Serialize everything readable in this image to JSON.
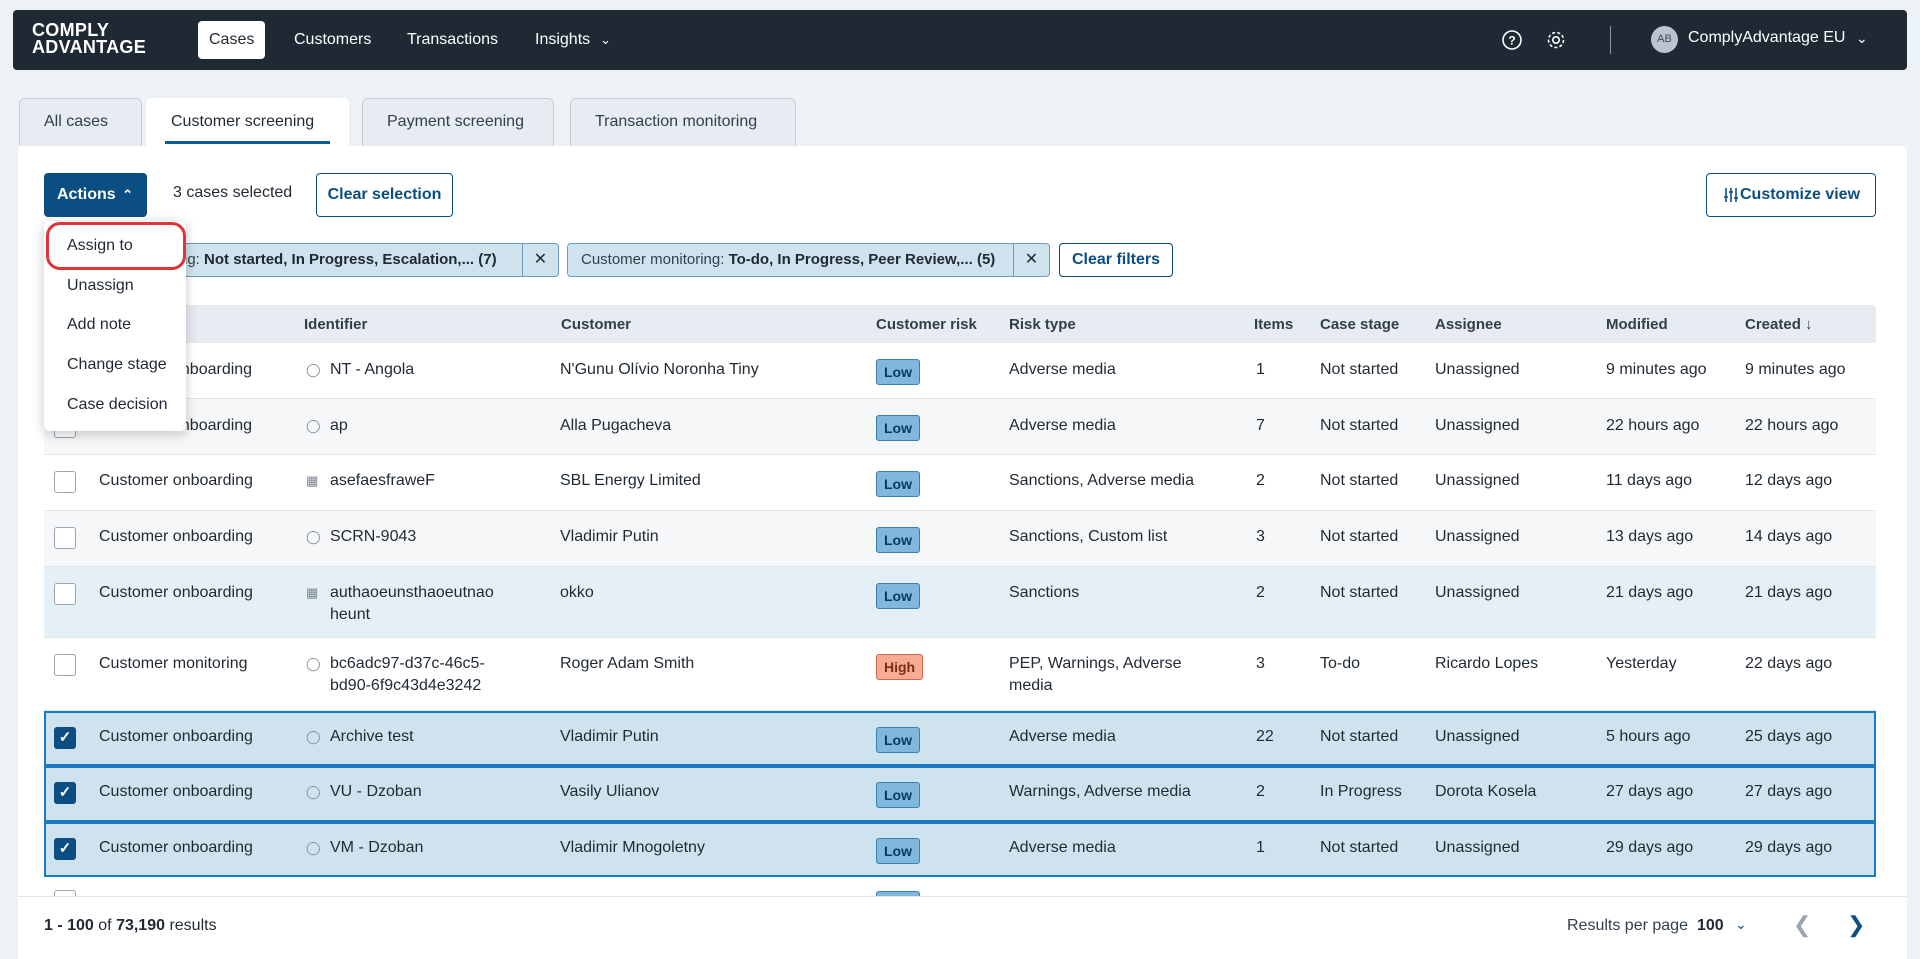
{
  "app": {
    "logo_line1": "COMPLY",
    "logo_line2": "ADVANTAGE"
  },
  "nav": {
    "cases": "Cases",
    "customers": "Customers",
    "transactions": "Transactions",
    "insights": "Insights",
    "account_initials": "AB",
    "account_name": "ComplyAdvantage EU"
  },
  "tabs": [
    "All cases",
    "Customer screening",
    "Payment screening",
    "Transaction monitoring"
  ],
  "toolbar": {
    "actions_label": "Actions",
    "selected_text": "3 cases selected",
    "clear_selection": "Clear selection",
    "customize_view": "Customize view"
  },
  "actions_menu": [
    "Assign to",
    "Unassign",
    "Add note",
    "Change stage",
    "Case decision"
  ],
  "filters": [
    {
      "prefix": "ng:",
      "value": "Not started, In Progress, Escalation,... (7)"
    },
    {
      "prefix": "Customer monitoring:",
      "value": "To-do, In Progress, Peer Review,... (5)"
    }
  ],
  "clear_filters": "Clear filters",
  "table": {
    "headers": {
      "identifier": "Identifier",
      "customer": "Customer",
      "customer_risk": "Customer risk",
      "risk_type": "Risk type",
      "items": "Items",
      "case_stage": "Case stage",
      "assignee": "Assignee",
      "modified": "Modified",
      "created": "Created ↓"
    },
    "rows": [
      {
        "type": "Customer onboarding",
        "visible_type": "onboarding",
        "id1": "NT - Angola",
        "id2": "",
        "customer": "N'Gunu Olívio Noronha Tiny",
        "risk": "Low",
        "risk_type1": "Adverse media",
        "risk_type2": "",
        "items": "1",
        "stage": "Not started",
        "assignee": "Unassigned",
        "modified": "9 minutes ago",
        "created": "9 minutes ago"
      },
      {
        "type": "Customer onboarding",
        "visible_type": "onboarding",
        "id1": "ap",
        "id2": "",
        "customer": "Alla Pugacheva",
        "risk": "Low",
        "risk_type1": "Adverse media",
        "risk_type2": "",
        "items": "7",
        "stage": "Not started",
        "assignee": "Unassigned",
        "modified": "22 hours ago",
        "created": "22 hours ago"
      },
      {
        "type": "Customer onboarding",
        "id1": "asefaesfraweF",
        "id2": "",
        "customer": "SBL Energy Limited",
        "risk": "Low",
        "risk_type1": "Sanctions, Adverse media",
        "risk_type2": "",
        "items": "2",
        "stage": "Not started",
        "assignee": "Unassigned",
        "modified": "11 days ago",
        "created": "12 days ago"
      },
      {
        "type": "Customer onboarding",
        "id1": "SCRN-9043",
        "id2": "",
        "customer": "Vladimir Putin",
        "risk": "Low",
        "risk_type1": "Sanctions, Custom list",
        "risk_type2": "",
        "items": "3",
        "stage": "Not started",
        "assignee": "Unassigned",
        "modified": "13 days ago",
        "created": "14 days ago"
      },
      {
        "type": "Customer onboarding",
        "id1": "authaoeunsthaoeutnao",
        "id2": "heunt",
        "customer": "okko",
        "risk": "Low",
        "risk_type1": "Sanctions",
        "risk_type2": "",
        "items": "2",
        "stage": "Not started",
        "assignee": "Unassigned",
        "modified": "21 days ago",
        "created": "21 days ago"
      },
      {
        "type": "Customer monitoring",
        "id1": "bc6adc97-d37c-46c5-",
        "id2": "bd90-6f9c43d4e3242",
        "customer": "Roger Adam Smith",
        "risk": "High",
        "risk_type1": "PEP, Warnings, Adverse",
        "risk_type2": "media",
        "items": "3",
        "stage": "To-do",
        "assignee": "Ricardo Lopes",
        "modified": "Yesterday",
        "created": "22 days ago"
      },
      {
        "type": "Customer onboarding",
        "id1": "Archive test",
        "id2": "",
        "customer": "Vladimir Putin",
        "risk": "Low",
        "risk_type1": "Adverse media",
        "risk_type2": "",
        "items": "22",
        "stage": "Not started",
        "assignee": "Unassigned",
        "modified": "5 hours ago",
        "created": "25 days ago"
      },
      {
        "type": "Customer onboarding",
        "id1": "VU - Dzoban",
        "id2": "",
        "customer": "Vasily Ulianov",
        "risk": "Low",
        "risk_type1": "Warnings, Adverse media",
        "risk_type2": "",
        "items": "2",
        "stage": "In Progress",
        "assignee": "Dorota Kosela",
        "modified": "27 days ago",
        "created": "27 days ago"
      },
      {
        "type": "Customer onboarding",
        "id1": "VM - Dzoban",
        "id2": "",
        "customer": "Vladimir Mnogoletny",
        "risk": "Low",
        "risk_type1": "Adverse media",
        "risk_type2": "",
        "items": "1",
        "stage": "Not started",
        "assignee": "Unassigned",
        "modified": "29 days ago",
        "created": "29 days ago"
      }
    ]
  },
  "footer": {
    "range": "1 - 100",
    "of_text": "of",
    "total": "73,190",
    "results_word": "results",
    "per_page_label": "Results per page",
    "per_page_value": "100"
  }
}
